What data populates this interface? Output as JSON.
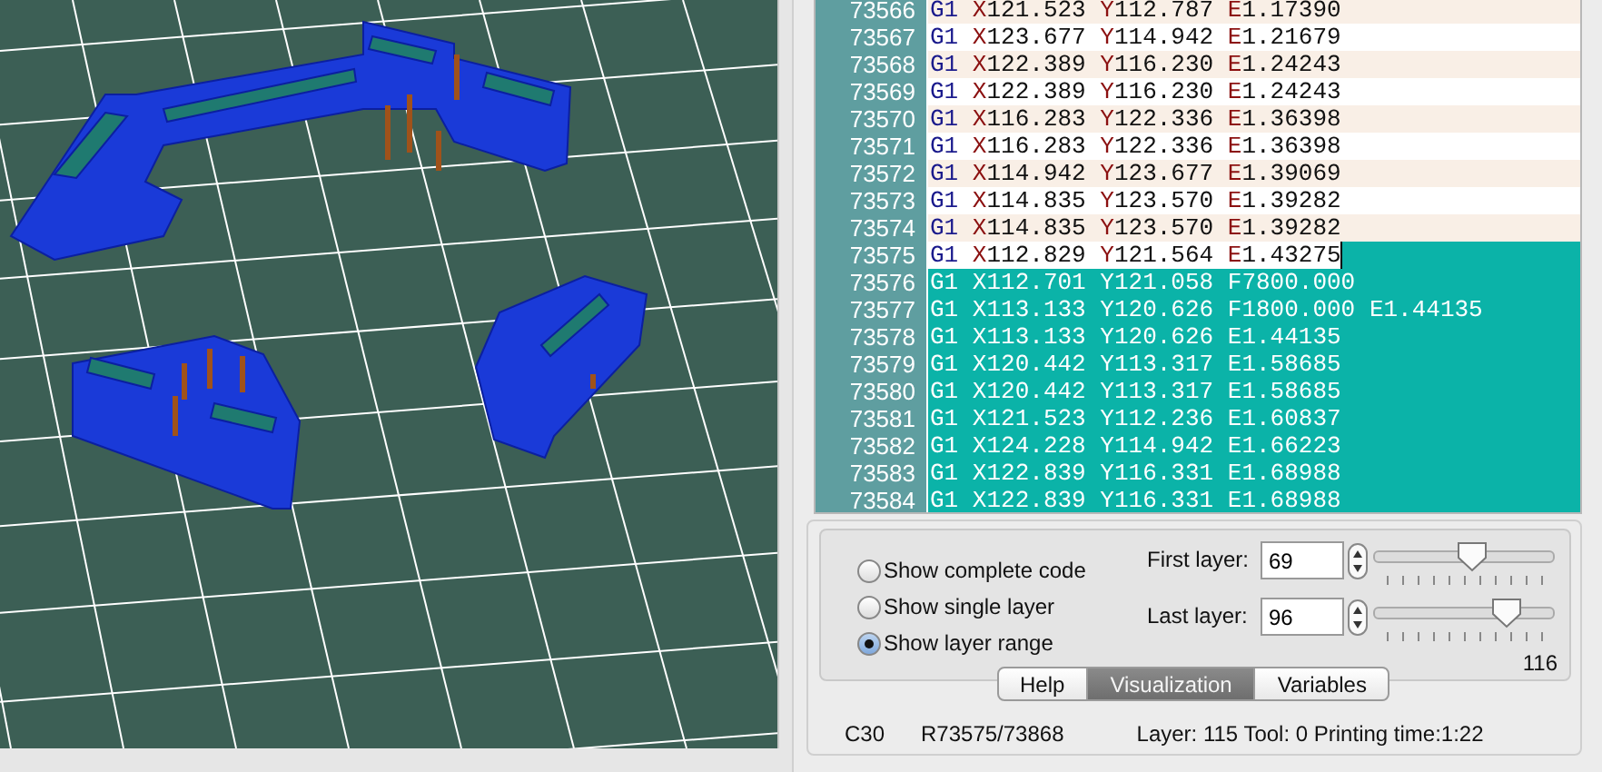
{
  "code_editor": {
    "lines": [
      {
        "number": "73566",
        "code": "G1 X121.523 Y112.787 E1.17390",
        "selected": false,
        "cursor": false
      },
      {
        "number": "73567",
        "code": "G1 X123.677 Y114.942 E1.21679",
        "selected": false,
        "cursor": false
      },
      {
        "number": "73568",
        "code": "G1 X122.389 Y116.230 E1.24243",
        "selected": false,
        "cursor": false
      },
      {
        "number": "73569",
        "code": "G1 X122.389 Y116.230 E1.24243",
        "selected": false,
        "cursor": false
      },
      {
        "number": "73570",
        "code": "G1 X116.283 Y122.336 E1.36398",
        "selected": false,
        "cursor": false
      },
      {
        "number": "73571",
        "code": "G1 X116.283 Y122.336 E1.36398",
        "selected": false,
        "cursor": false
      },
      {
        "number": "73572",
        "code": "G1 X114.942 Y123.677 E1.39069",
        "selected": false,
        "cursor": false
      },
      {
        "number": "73573",
        "code": "G1 X114.835 Y123.570 E1.39282",
        "selected": false,
        "cursor": false
      },
      {
        "number": "73574",
        "code": "G1 X114.835 Y123.570 E1.39282",
        "selected": false,
        "cursor": false
      },
      {
        "number": "73575",
        "code": "G1 X112.829 Y121.564 E1.43275",
        "selected": false,
        "cursor": true
      },
      {
        "number": "73576",
        "code": "G1 X112.701 Y121.058 F7800.000",
        "selected": true,
        "cursor": false
      },
      {
        "number": "73577",
        "code": "G1 X113.133 Y120.626 F1800.000 E1.44135",
        "selected": true,
        "cursor": false
      },
      {
        "number": "73578",
        "code": "G1 X113.133 Y120.626 E1.44135",
        "selected": true,
        "cursor": false
      },
      {
        "number": "73579",
        "code": "G1 X120.442 Y113.317 E1.58685",
        "selected": true,
        "cursor": false
      },
      {
        "number": "73580",
        "code": "G1 X120.442 Y113.317 E1.58685",
        "selected": true,
        "cursor": false
      },
      {
        "number": "73581",
        "code": "G1 X121.523 Y112.236 E1.60837",
        "selected": true,
        "cursor": false
      },
      {
        "number": "73582",
        "code": "G1 X124.228 Y114.942 E1.66223",
        "selected": true,
        "cursor": false
      },
      {
        "number": "73583",
        "code": "G1 X122.839 Y116.331 E1.68988",
        "selected": true,
        "cursor": false
      },
      {
        "number": "73584",
        "code": "G1 X122.839 Y116.331 E1.68988",
        "selected": true,
        "cursor": false
      }
    ]
  },
  "display_mode": {
    "options": [
      {
        "label": "Show complete code",
        "selected": false
      },
      {
        "label": "Show single layer",
        "selected": false
      },
      {
        "label": "Show layer range",
        "selected": true
      }
    ]
  },
  "layer_range": [
    {
      "label": "First layer:",
      "value": "69",
      "level": 0.55
    },
    {
      "label": "Last layer:",
      "value": "96",
      "level": 0.78,
      "reading": "116"
    }
  ],
  "tabs": [
    {
      "label": "Help",
      "selected": false
    },
    {
      "label": "Visualization",
      "selected": true
    },
    {
      "label": "Variables",
      "selected": false
    }
  ],
  "status_bar": {
    "column": "C30",
    "row": "R73575/73868",
    "info": "Layer: 115 Tool: 0 Printing time:1:22"
  }
}
